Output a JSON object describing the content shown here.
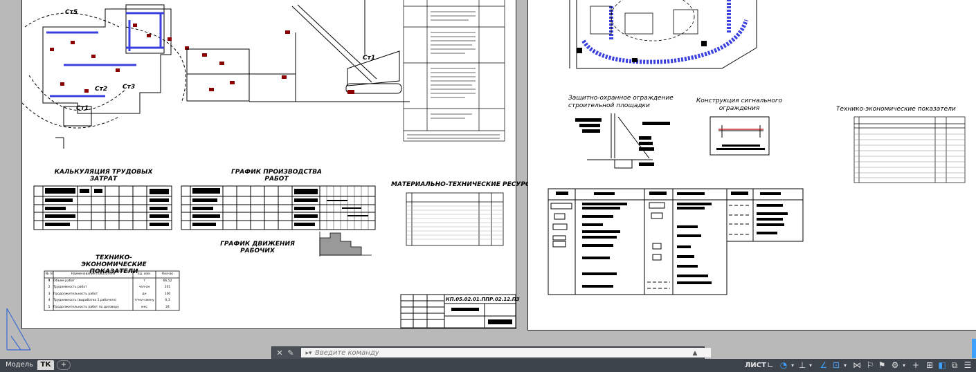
{
  "sheet_left": {
    "titles": {
      "calc": "КАЛЬКУЛЯЦИЯ ТРУДОВЫХ\nЗАТРАТ",
      "schedule": "ГРАФИК ПРОИЗВОДСТВА\nРАБОТ",
      "resources": "МАТЕРИАЛЬНО-ТЕХНИЧЕСКИЕ РЕСУРСЫ",
      "workers": "ГРАФИК ДВИЖЕНИЯ\nРАБОЧИХ",
      "tep": "ТЕХНИКО-ЭКОНОМИЧЕСКИЕ\nПОКАЗАТЕЛИ"
    },
    "plan_labels": [
      "Ст5",
      "Ст2",
      "Ст3",
      "Ст1"
    ],
    "crane_label": "Ст1",
    "title_block_code": "КП.05.02.01.ППР.02.12.ПЗ",
    "tep_table": {
      "headers": [
        "№ п/п",
        "Наименование показателя",
        "Ед. изм.",
        "Кол-во"
      ],
      "rows": [
        [
          "1",
          "Объем работ",
          "т",
          "66,52"
        ],
        [
          "2",
          "Трудоемкость работ",
          "чел-см",
          "201"
        ],
        [
          "3",
          "Продолжительность работ",
          "дн",
          "100"
        ],
        [
          "4",
          "Трудоемкость (выработка 1 рабочего)",
          "т/чел-смену",
          "0,3"
        ],
        [
          "5",
          "Продолжительность работ по договору",
          "мес",
          "24"
        ]
      ]
    }
  },
  "sheet_right": {
    "titles": {
      "fence": "Защитно-охранное ограждение\nстроительной площадки",
      "signal": "Конструкция сигнального\nограждения",
      "tep": "Технико-экономические показатели"
    }
  },
  "command_line": {
    "placeholder": "Введите команду"
  },
  "status_bar": {
    "tabs": [
      "Модель",
      "ТК"
    ],
    "add_tab": "+",
    "layout_label": "ЛИСТ"
  }
}
